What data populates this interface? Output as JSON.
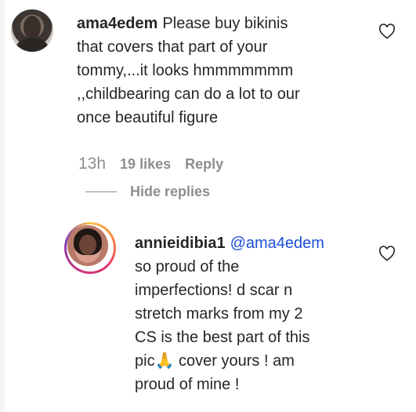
{
  "comments": [
    {
      "username": "ama4edem",
      "lines": [
        "Please buy bikinis",
        "that covers that part of your",
        "tommy,...it looks hmmmmmmm",
        ",,childbearing can do a lot to our",
        "once beautiful figure"
      ],
      "time": "13h",
      "likes": "19 likes",
      "reply": "Reply"
    }
  ],
  "hide_replies": "Hide replies",
  "reply_comment": {
    "username": "annieidibia1",
    "mention": "@ama4edem",
    "lines": [
      "so proud of the",
      "imperfections! d scar n",
      "stretch marks from my 2",
      "CS is the best part of this",
      "pic",
      " cover yours ! am",
      "proud of mine !"
    ],
    "emoji": "🙏"
  },
  "icons": {
    "like": "heart-outline-icon"
  },
  "colors": {
    "text": "#262626",
    "muted": "#8e8e8e",
    "link": "#1d4ed8"
  }
}
